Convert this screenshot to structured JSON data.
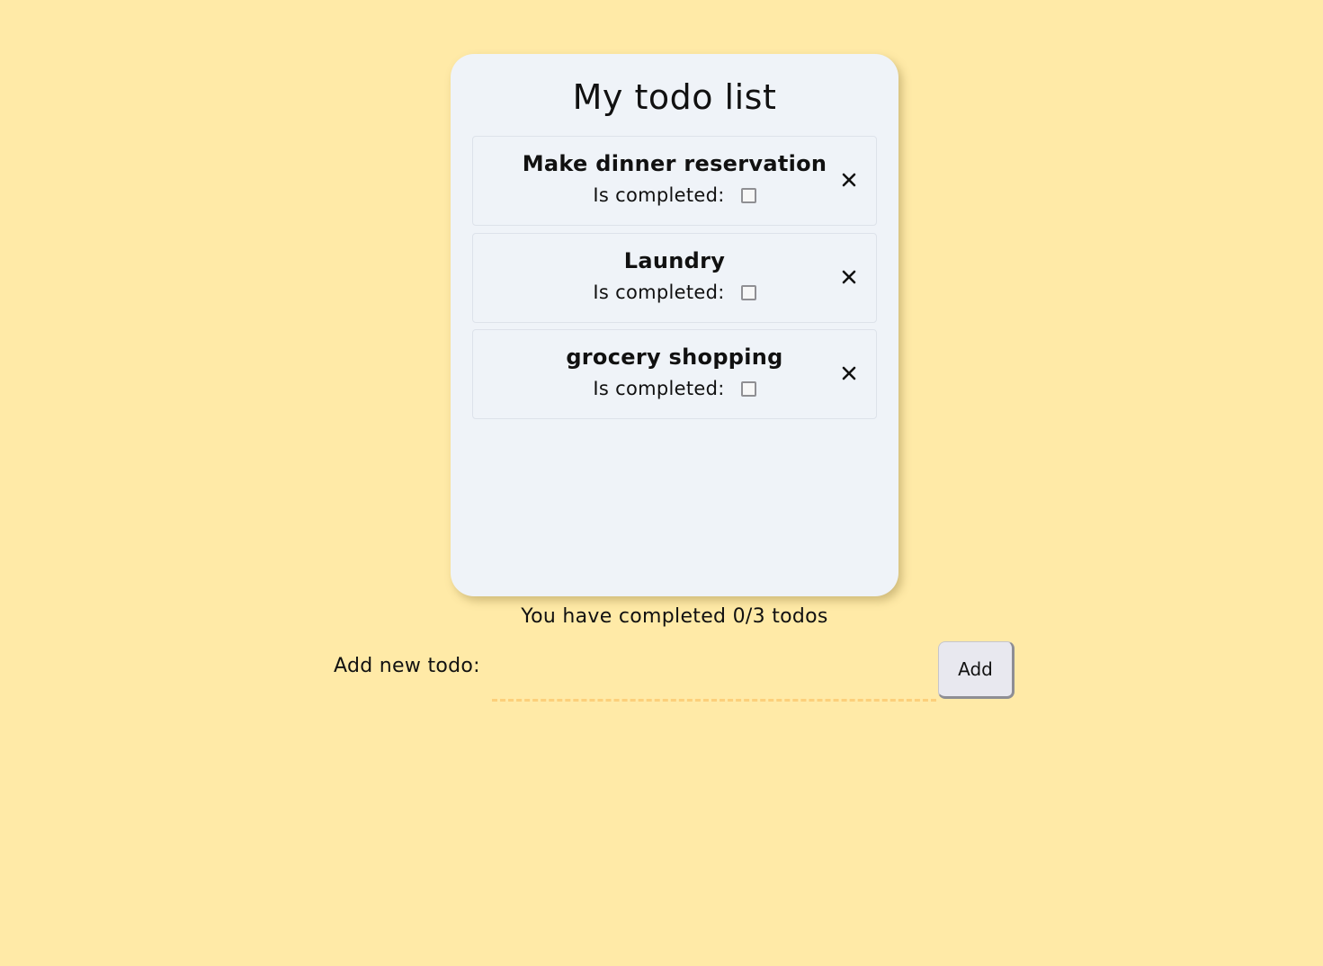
{
  "title": "My todo list",
  "todos": [
    {
      "name": "Make dinner reservation",
      "status_label": "Is completed:",
      "completed": false
    },
    {
      "name": "Laundry",
      "status_label": "Is completed:",
      "completed": false
    },
    {
      "name": "grocery shopping",
      "status_label": "Is completed:",
      "completed": false
    }
  ],
  "progress_text": "You have completed 0/3 todos",
  "add_form": {
    "label": "Add new todo:",
    "input_value": "",
    "button_label": "Add"
  },
  "colors": {
    "background": "#ffeaa7",
    "card": "#eff3f8",
    "input_underline": "#fccf7a",
    "button": "#e8e8ef"
  },
  "icons": {
    "delete": "close-icon"
  }
}
